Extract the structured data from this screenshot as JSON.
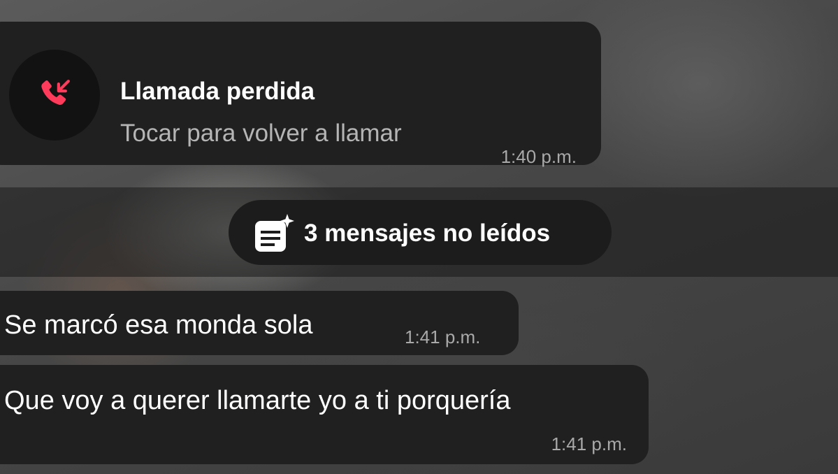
{
  "missed_call": {
    "title": "Llamada perdida",
    "subtitle": "Tocar para volver a llamar",
    "time": "1:40 p.m.",
    "icon": "missed-call-icon",
    "icon_color": "#ff3b5c"
  },
  "unread_banner": {
    "label": "3 mensajes no leídos",
    "icon": "unread-messages-icon"
  },
  "messages": [
    {
      "text": "Se marcó esa monda sola",
      "time": "1:41 p.m."
    },
    {
      "text": "Que voy a querer llamarte yo a ti porquería",
      "time": "1:41 p.m."
    }
  ],
  "colors": {
    "bubble": "#202021",
    "timestamp": "#a9a9a9",
    "subtitle": "#b5b5b5"
  }
}
